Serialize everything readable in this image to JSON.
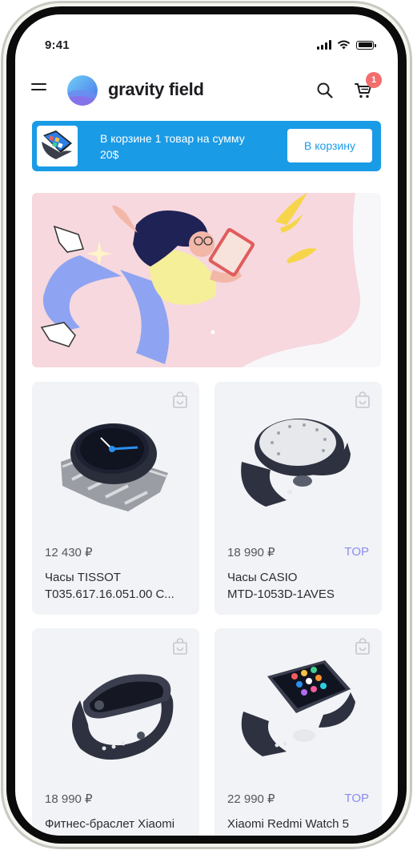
{
  "status_bar": {
    "time": "9:41"
  },
  "header": {
    "logo_text": "gravity field",
    "cart_badge": "1"
  },
  "cart_banner": {
    "message": "В корзине 1 товар на сумму 20$",
    "button_label": "В корзину"
  },
  "products": [
    {
      "price": "12 430 ₽",
      "tag": "",
      "name_line1": "Часы TISSOT",
      "name_line2": "T035.617.16.051.00 C..."
    },
    {
      "price": "18 990 ₽",
      "tag": "TOP",
      "name_line1": "Часы CASIO",
      "name_line2": "MTD-1053D-1AVES"
    },
    {
      "price": "18 990 ₽",
      "tag": "",
      "name_line1": "Фитнес-браслет Xiaomi",
      "name_line2": ""
    },
    {
      "price": "22 990 ₽",
      "tag": "TOP",
      "name_line1": "Xiaomi Redmi Watch 5",
      "name_line2": ""
    }
  ],
  "colors": {
    "accent": "#1a9be6",
    "badge": "#f26d6d",
    "tag": "#8a8cf0",
    "card_bg": "#f1f3f6",
    "hero_bg": "#f6d8de"
  },
  "icons": [
    "menu-icon",
    "search-icon",
    "cart-icon",
    "shopping-bag-icon",
    "signal-icon",
    "wifi-icon",
    "battery-icon"
  ]
}
